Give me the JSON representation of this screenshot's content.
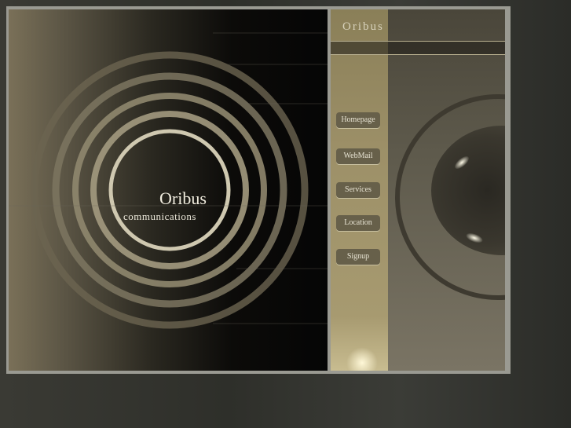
{
  "logo": {
    "name": "Oribus",
    "tagline": "communications"
  },
  "side_panel": {
    "title": "Oribus"
  },
  "nav": [
    {
      "label": "Homepage"
    },
    {
      "label": "WebMail"
    },
    {
      "label": "Services"
    },
    {
      "label": "Location"
    },
    {
      "label": "Signup"
    }
  ]
}
